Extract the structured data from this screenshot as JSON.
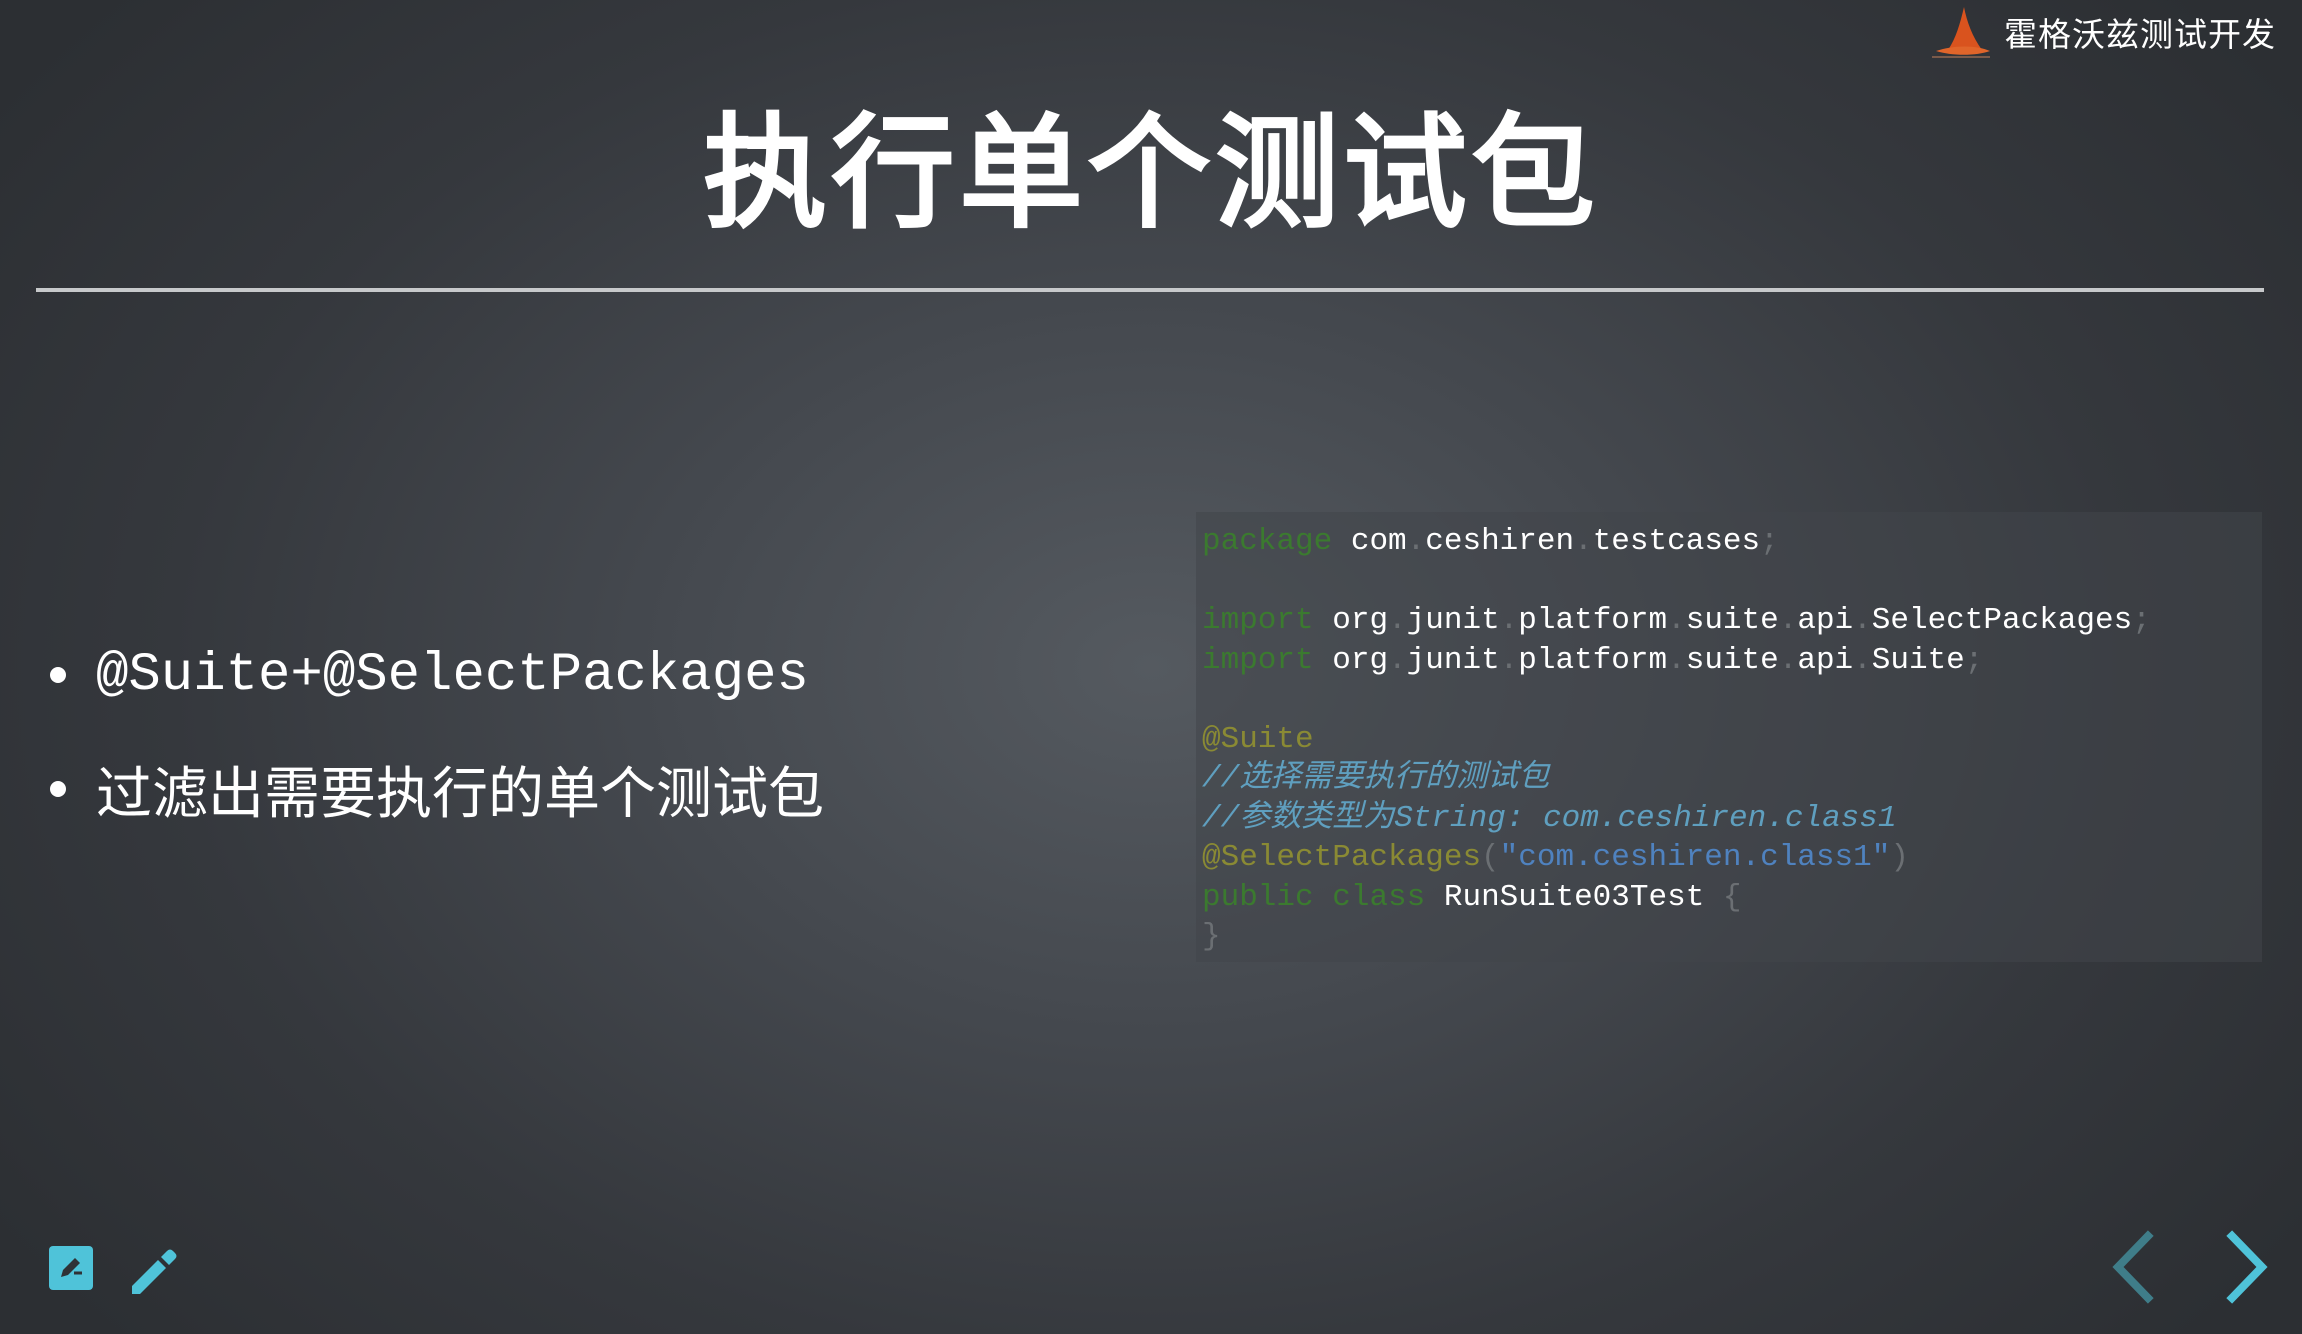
{
  "brand": {
    "name": "霍格沃兹测试开发"
  },
  "slide": {
    "title": "执行单个测试包",
    "bullets": [
      "@Suite+@SelectPackages",
      "过滤出需要执行的单个测试包"
    ]
  },
  "code": {
    "package_kw": "package",
    "package_name": [
      "com",
      "ceshiren",
      "testcases"
    ],
    "import_kw": "import",
    "import1": [
      "org",
      "junit",
      "platform",
      "suite",
      "api",
      "SelectPackages"
    ],
    "import2": [
      "org",
      "junit",
      "platform",
      "suite",
      "api",
      "Suite"
    ],
    "dot": ".",
    "semicolon": ";",
    "annotation_suite": "@Suite",
    "comment1": "//选择需要执行的测试包",
    "comment2": "//参数类型为String: com.ceshiren.class1",
    "annotation_select": "@SelectPackages",
    "paren_open": "(",
    "paren_close": ")",
    "select_value": "\"com.ceshiren.class1\"",
    "public_kw": "public",
    "class_kw": "class",
    "class_name": "RunSuite03Test",
    "brace_open": "{",
    "brace_close": "}"
  },
  "controls": {
    "icons": [
      "edit-square-icon",
      "pencil-icon",
      "chevron-left-icon",
      "chevron-right-icon"
    ],
    "accent_color": "#4fc3d9",
    "disabled_color": "#3f7d89"
  },
  "colors": {
    "keyword": "#3b7a2f",
    "annotation": "#8a8a34",
    "comment": "#5f9fbf",
    "string": "#4f82bf"
  }
}
